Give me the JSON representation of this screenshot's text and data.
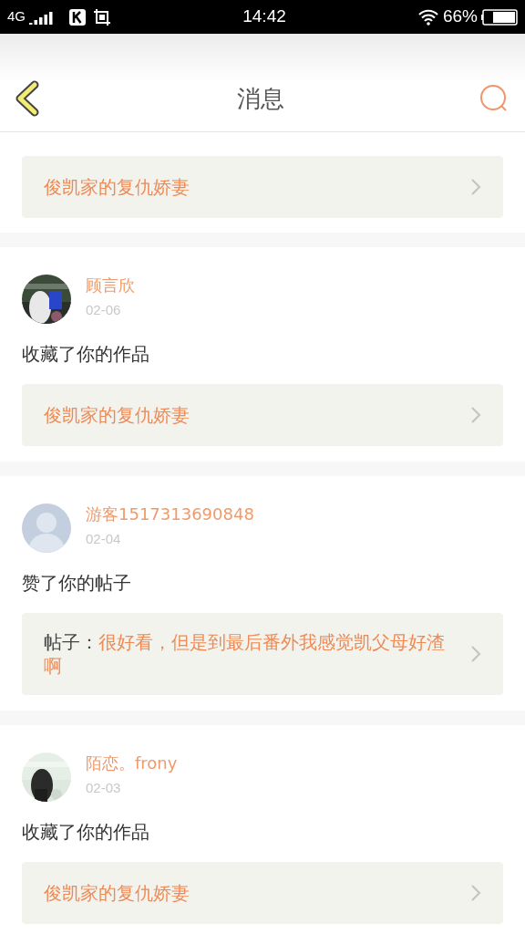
{
  "status_bar": {
    "network": "4G",
    "time": "14:42",
    "battery": "66%"
  },
  "header": {
    "title": "消息"
  },
  "partial_top": {
    "link": "俊凯家的复仇娇妻"
  },
  "messages": [
    {
      "name": "顾言欣",
      "date": "02-06",
      "action": "收藏了你的作品",
      "kind": "work",
      "link": "俊凯家的复仇娇妻"
    },
    {
      "avatar": {
        "kind": "silhouette"
      },
      "name": "游客1517313690848",
      "date": "02-04",
      "action": "赞了你的帖子",
      "kind": "post",
      "label": "帖子：",
      "link": "很好看，但是到最后番外我感觉凯父母好渣啊"
    },
    {
      "name": "陌恋。frony",
      "date": "02-03",
      "action": "收藏了你的作品",
      "kind": "work",
      "link": "俊凯家的复仇娇妻"
    }
  ]
}
